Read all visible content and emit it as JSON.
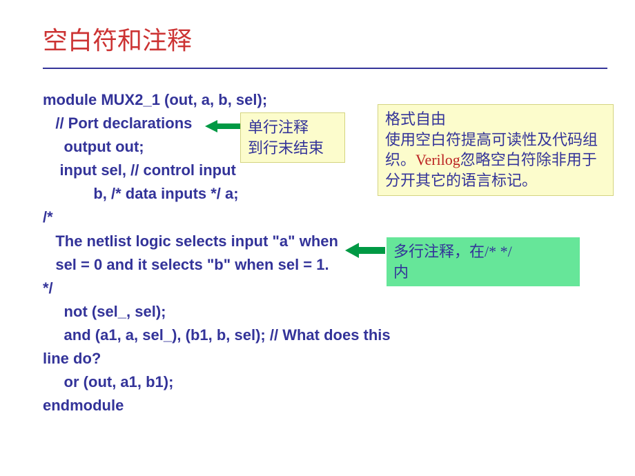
{
  "title": "空白符和注释",
  "code": {
    "l1": "module MUX2_1 (out, a, b, sel);",
    "l2": "   // Port declarations",
    "l3": "     output out;",
    "l4": "    input sel, // control input",
    "l5": "            b, /* data inputs */ a;",
    "l6": "/*",
    "l7": "   The netlist logic selects input \"a\" when",
    "l8": "   sel = 0 and it selects \"b\" when sel = 1.",
    "l9": "*/",
    "l10": "     not (sel_, sel);",
    "l11": "     and (a1, a, sel_), (b1, b, sel); // What does this",
    "l11b": "line do?",
    "l12": "     or (out, a1, b1);",
    "l13": "endmodule"
  },
  "annotations": {
    "single_comment_l1": "单行注释",
    "single_comment_l2": "到行末结束",
    "free_format_l1": "格式自由",
    "free_format_l2a": "使用空白符提高可读性及代码组",
    "free_format_l2b": "织。",
    "free_format_l2c": "Verilog",
    "free_format_l2d": "忽略空白符除非用于",
    "free_format_l3": "分开其它的语言标记。",
    "multi_comment_l1a": "多行注释，在",
    "multi_comment_l1b": "/*    */",
    "multi_comment_l2": "内"
  }
}
